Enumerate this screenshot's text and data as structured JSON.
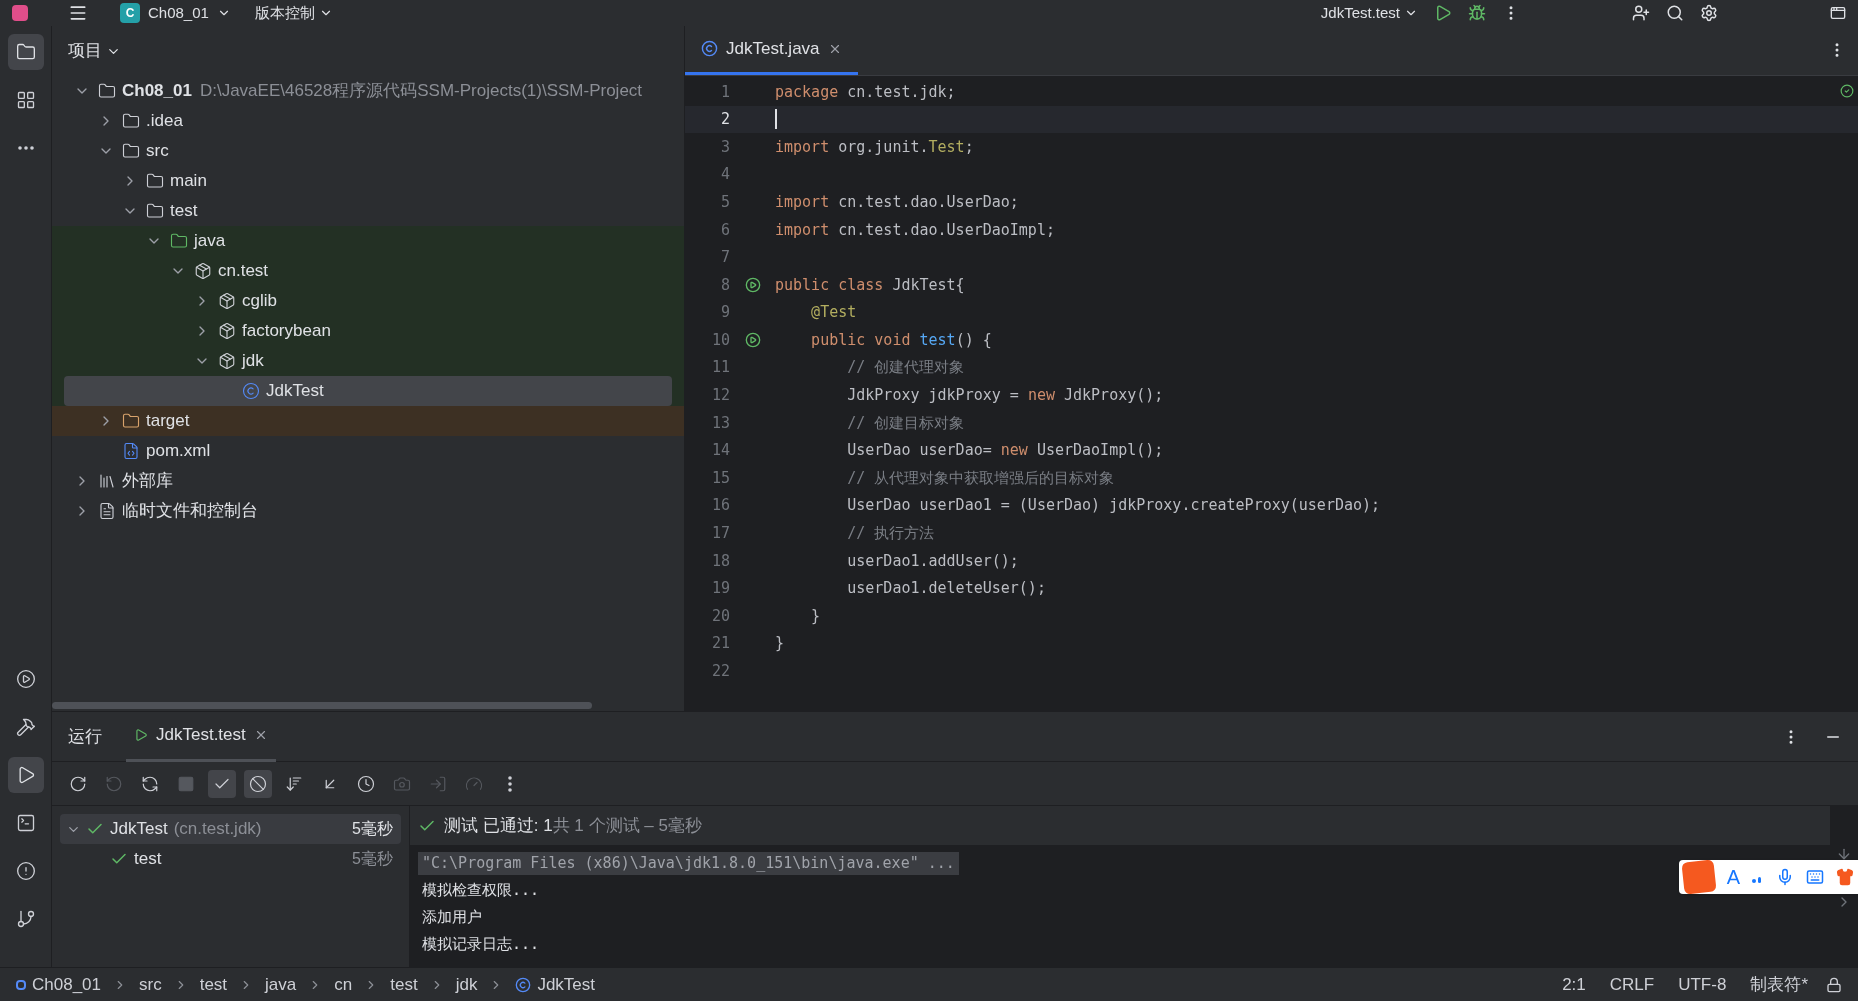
{
  "top_bar": {
    "project": {
      "badge": "C",
      "name": "Ch08_01"
    },
    "vcs": "版本控制",
    "run_config": "JdkTest.test"
  },
  "left_stripe": [
    {
      "kind": "project",
      "selected": true
    },
    {
      "kind": "structure",
      "selected": false
    },
    {
      "kind": "more",
      "selected": false
    }
  ],
  "left_stripe_bottom": [
    {
      "kind": "services",
      "selected": false
    },
    {
      "kind": "build",
      "selected": false
    },
    {
      "kind": "run",
      "selected": true
    },
    {
      "kind": "terminal",
      "selected": false
    },
    {
      "kind": "problems",
      "selected": false
    },
    {
      "kind": "git",
      "selected": false
    }
  ],
  "project_panel": {
    "title": "项目",
    "tree": [
      {
        "kind": "module",
        "name": "Ch08_01",
        "path": "D:\\JavaEE\\46528程序源代码SSM-Projects(1)\\SSM-Project",
        "expanded": true,
        "selected": false,
        "children": [
          {
            "kind": "folder",
            "name": ".idea",
            "expanded": false,
            "selected": false
          },
          {
            "kind": "folder",
            "name": "src",
            "expanded": true,
            "selected": false,
            "children": [
              {
                "kind": "folder",
                "name": "main",
                "expanded": false,
                "selected": false
              },
              {
                "kind": "folder",
                "name": "test",
                "expanded": true,
                "selected": false,
                "children": [
                  {
                    "kind": "test_root",
                    "name": "java",
                    "expanded": true,
                    "selected": false,
                    "children": [
                      {
                        "kind": "package",
                        "name": "cn.test",
                        "expanded": true,
                        "selected": false,
                        "children": [
                          {
                            "kind": "package",
                            "name": "cglib",
                            "expanded": false,
                            "selected": false
                          },
                          {
                            "kind": "package",
                            "name": "factorybean",
                            "expanded": false,
                            "selected": false
                          },
                          {
                            "kind": "package",
                            "name": "jdk",
                            "expanded": true,
                            "selected": false,
                            "children": [
                              {
                                "kind": "class",
                                "name": "JdkTest",
                                "selected": true
                              }
                            ]
                          }
                        ]
                      }
                    ]
                  }
                ]
              }
            ]
          },
          {
            "kind": "excluded",
            "name": "target",
            "expanded": false,
            "selected": false
          },
          {
            "kind": "maven",
            "name": "pom.xml",
            "selected": false
          }
        ]
      },
      {
        "kind": "library",
        "name": "外部库",
        "expanded": false,
        "selected": false
      },
      {
        "kind": "scratches",
        "name": "临时文件和控制台",
        "expanded": false,
        "selected": false
      }
    ]
  },
  "editor": {
    "tabs": [
      {
        "label": "JdkTest.java",
        "selected": true
      }
    ],
    "lines": [
      {
        "n": "1",
        "current": false,
        "parts": [
          {
            "text": "package",
            "kind": "keyword"
          },
          {
            "text": " cn.test.jdk;",
            "kind": "plain"
          }
        ]
      },
      {
        "n": "2",
        "current": true
      },
      {
        "n": "3",
        "current": false,
        "parts": [
          {
            "text": "import",
            "kind": "keyword"
          },
          {
            "text": " org.junit.",
            "kind": "plain"
          },
          {
            "text": "Test",
            "kind": "annotation"
          },
          {
            "text": ";",
            "kind": "plain"
          }
        ]
      },
      {
        "n": "4",
        "current": false
      },
      {
        "n": "5",
        "current": false,
        "parts": [
          {
            "text": "import",
            "kind": "keyword"
          },
          {
            "text": " cn.test.dao.UserDao;",
            "kind": "plain"
          }
        ]
      },
      {
        "n": "6",
        "current": false,
        "parts": [
          {
            "text": "import",
            "kind": "keyword"
          },
          {
            "text": " cn.test.dao.UserDaoImpl;",
            "kind": "plain"
          }
        ]
      },
      {
        "n": "7",
        "current": false
      },
      {
        "n": "8",
        "current": false,
        "run": true,
        "parts": [
          {
            "text": "public class",
            "kind": "keyword"
          },
          {
            "text": " JdkTest{",
            "kind": "plain"
          }
        ]
      },
      {
        "n": "9",
        "current": false,
        "parts": [
          {
            "text": "    @Test",
            "kind": "annotation"
          }
        ]
      },
      {
        "n": "10",
        "current": false,
        "run": true,
        "parts": [
          {
            "text": "    public void ",
            "kind": "keyword"
          },
          {
            "text": "test",
            "kind": "method"
          },
          {
            "text": "() {",
            "kind": "plain"
          }
        ]
      },
      {
        "n": "11",
        "current": false,
        "parts": [
          {
            "text": "        // 创建代理对象",
            "kind": "comment"
          }
        ]
      },
      {
        "n": "12",
        "current": false,
        "parts": [
          {
            "text": "        JdkProxy jdkProxy = ",
            "kind": "plain"
          },
          {
            "text": "new",
            "kind": "keyword"
          },
          {
            "text": " JdkProxy();",
            "kind": "plain"
          }
        ]
      },
      {
        "n": "13",
        "current": false,
        "parts": [
          {
            "text": "        // 创建目标对象",
            "kind": "comment"
          }
        ]
      },
      {
        "n": "14",
        "current": false,
        "parts": [
          {
            "text": "        UserDao userDao= ",
            "kind": "plain"
          },
          {
            "text": "new",
            "kind": "keyword"
          },
          {
            "text": " UserDaoImpl();",
            "kind": "plain"
          }
        ]
      },
      {
        "n": "15",
        "current": false,
        "parts": [
          {
            "text": "        // 从代理对象中获取增强后的目标对象",
            "kind": "comment"
          }
        ]
      },
      {
        "n": "16",
        "current": false,
        "parts": [
          {
            "text": "        UserDao userDao1 = (UserDao) jdkProxy.createProxy(userDao);",
            "kind": "plain"
          }
        ]
      },
      {
        "n": "17",
        "current": false,
        "parts": [
          {
            "text": "        // 执行方法",
            "kind": "comment"
          }
        ]
      },
      {
        "n": "18",
        "current": false,
        "parts": [
          {
            "text": "        userDao1.addUser();",
            "kind": "plain"
          }
        ]
      },
      {
        "n": "19",
        "current": false,
        "parts": [
          {
            "text": "        userDao1.deleteUser();",
            "kind": "plain"
          }
        ]
      },
      {
        "n": "20",
        "current": false,
        "parts": [
          {
            "text": "    }",
            "kind": "plain"
          }
        ]
      },
      {
        "n": "21",
        "current": false,
        "parts": [
          {
            "text": "}",
            "kind": "plain"
          }
        ]
      },
      {
        "n": "22",
        "current": false
      }
    ]
  },
  "run_panel": {
    "title": "运行",
    "tabs": [
      {
        "label": "JdkTest.test",
        "selected": true
      }
    ],
    "toolbar": [
      {
        "kind": "rerun",
        "on": false,
        "disabled": false
      },
      {
        "kind": "rerun_failed",
        "on": false,
        "disabled": true
      },
      {
        "kind": "auto_test",
        "on": false,
        "disabled": false
      },
      {
        "kind": "stop",
        "on": false,
        "disabled": true
      },
      {
        "kind": "show_passed",
        "on": true,
        "disabled": false
      },
      {
        "kind": "show_ignored",
        "on": true,
        "disabled": false
      },
      {
        "kind": "sort",
        "on": false,
        "disabled": false
      },
      {
        "kind": "collapse",
        "on": false,
        "disabled": false
      },
      {
        "kind": "history",
        "on": false,
        "disabled": false
      },
      {
        "kind": "camera",
        "on": false,
        "disabled": true
      },
      {
        "kind": "export",
        "on": false,
        "disabled": true
      },
      {
        "kind": "gauge",
        "on": false,
        "disabled": true
      },
      {
        "kind": "more",
        "on": false,
        "disabled": false
      }
    ],
    "tests": [
      {
        "name": "JdkTest",
        "package": "(cn.test.jdk)",
        "time": "5毫秒",
        "passed": true,
        "expanded": true,
        "selected": true,
        "children": [
          {
            "name": "test",
            "time": "5毫秒",
            "passed": true,
            "selected": false
          }
        ]
      }
    ],
    "summary": {
      "passed": true,
      "status": "测试 已通过: 1",
      "detail": "共 1 个测试 – 5毫秒"
    },
    "console": [
      {
        "text": "\"C:\\Program Files (x86)\\Java\\jdk1.8.0_151\\bin\\java.exe\" ...",
        "kind": "command"
      },
      {
        "text": "模拟检查权限...",
        "kind": "output"
      },
      {
        "text": "添加用户",
        "kind": "output"
      },
      {
        "text": "模拟记录日志...",
        "kind": "output"
      }
    ]
  },
  "ime_toolbar": {
    "mode": "A"
  },
  "breadcrumbs": [
    {
      "label": "Ch08_01",
      "kind": "module"
    },
    {
      "label": "src",
      "kind": "plain"
    },
    {
      "label": "test",
      "kind": "plain"
    },
    {
      "label": "java",
      "kind": "plain"
    },
    {
      "label": "cn",
      "kind": "plain"
    },
    {
      "label": "test",
      "kind": "plain"
    },
    {
      "label": "jdk",
      "kind": "plain"
    },
    {
      "label": "JdkTest",
      "kind": "class"
    }
  ],
  "status": [
    "2:1",
    "CRLF",
    "UTF-8",
    "制表符*"
  ]
}
